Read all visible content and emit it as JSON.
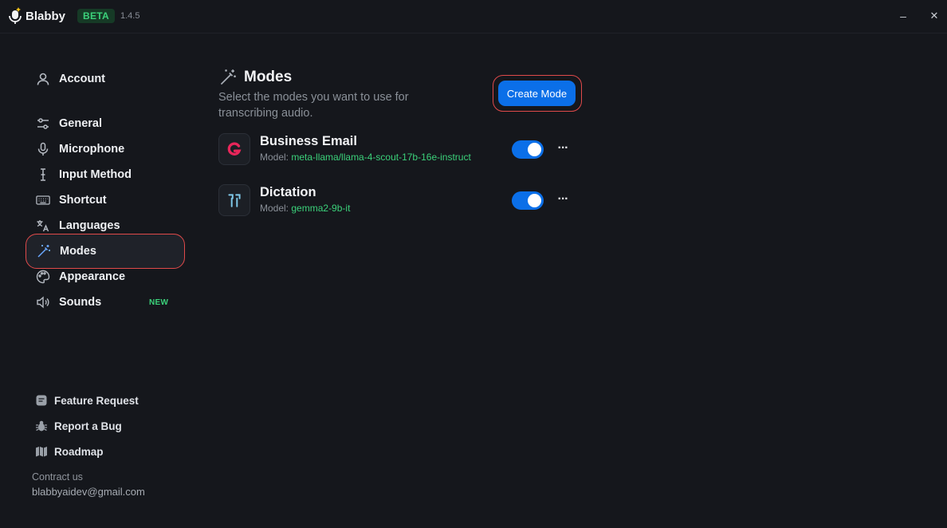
{
  "titlebar": {
    "app_name": "Blabby",
    "badge": "BETA",
    "version": "1.4.5",
    "minimize_symbol": "–",
    "close_symbol": "✕",
    "logo_icon": "microphone-logo-icon"
  },
  "sidebar": {
    "items": [
      {
        "label": "Account",
        "icon": "user-icon"
      },
      {
        "label": "General",
        "icon": "sliders-icon"
      },
      {
        "label": "Microphone",
        "icon": "microphone-icon"
      },
      {
        "label": "Input Method",
        "icon": "text-cursor-icon"
      },
      {
        "label": "Shortcut",
        "icon": "keyboard-icon"
      },
      {
        "label": "Languages",
        "icon": "translate-icon"
      },
      {
        "label": "Modes",
        "icon": "magic-wand-icon",
        "active": true
      },
      {
        "label": "Appearance",
        "icon": "palette-icon"
      },
      {
        "label": "Sounds",
        "icon": "speaker-icon",
        "badge": "NEW"
      }
    ],
    "footer": [
      {
        "label": "Feature Request",
        "icon": "message-icon"
      },
      {
        "label": "Report a Bug",
        "icon": "bug-icon"
      },
      {
        "label": "Roadmap",
        "icon": "map-icon"
      }
    ],
    "contact_label": "Contract us",
    "contact_email": "blabbyaidev@gmail.com"
  },
  "main": {
    "title": "Modes",
    "subtitle": "Select the modes you want to use for transcribing audio.",
    "create_button": "Create Mode",
    "modes": [
      {
        "name": "Business Email",
        "model_label": "Model:",
        "model": "meta-llama/llama-4-scout-17b-16e-instruct",
        "enabled": true,
        "icon": "groq-g-icon",
        "more": "···"
      },
      {
        "name": "Dictation",
        "model_label": "Model:",
        "model": "gemma2-9b-it",
        "enabled": true,
        "icon": "earbuds-icon",
        "more": "···"
      }
    ]
  },
  "colors": {
    "accent": "#0b6fe8",
    "success": "#3bd17a",
    "highlight": "#e04a4a",
    "background": "#15171c"
  }
}
